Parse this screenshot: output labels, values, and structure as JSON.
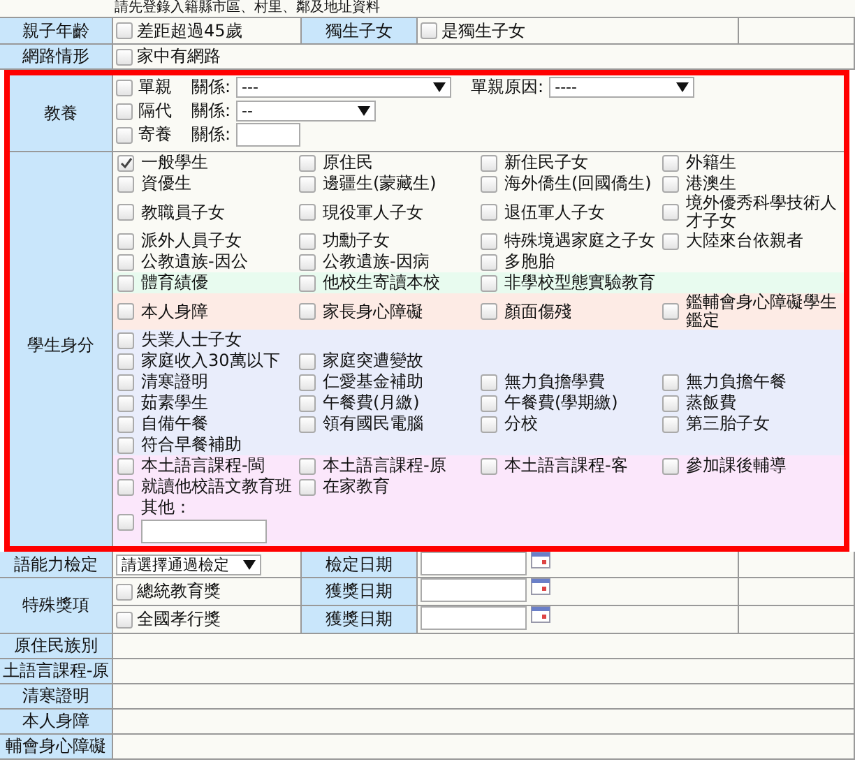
{
  "note": "請先登錄入籍縣市區、村里、鄰及地址資料",
  "parent_age": {
    "label": "親子年齡",
    "option": {
      "label": "差距超過45歲",
      "checked": false
    },
    "label2": "獨生子女",
    "option2": {
      "label": "是獨生子女",
      "checked": false
    }
  },
  "internet": {
    "label": "網路情形",
    "option": {
      "label": "家中有網路",
      "checked": false
    }
  },
  "upbringing": {
    "label": "教養",
    "items": [
      {
        "label": "單親",
        "checked": false,
        "relation_label": "關係:",
        "kind": "select",
        "value": "---",
        "reason_label": "單親原因:",
        "reason_value": "----"
      },
      {
        "label": "隔代",
        "checked": false,
        "relation_label": "關係:",
        "kind": "select",
        "value": "--"
      },
      {
        "label": "寄養",
        "checked": false,
        "relation_label": "關係:",
        "kind": "input"
      }
    ]
  },
  "identity": {
    "label": "學生身分",
    "groups": [
      {
        "color": "#fafaf5",
        "rows": [
          [
            {
              "label": "一般學生",
              "checked": true
            },
            {
              "label": "原住民",
              "checked": false
            },
            {
              "label": "新住民子女",
              "checked": false
            },
            {
              "label": "外籍生",
              "checked": false
            }
          ],
          [
            {
              "label": "資優生",
              "checked": false
            },
            {
              "label": "邊疆生(蒙藏生)",
              "checked": false
            },
            {
              "label": "海外僑生(回國僑生)",
              "checked": false
            },
            {
              "label": "港澳生",
              "checked": false
            }
          ],
          [
            {
              "label": "教職員子女",
              "checked": false
            },
            {
              "label": "現役軍人子女",
              "checked": false
            },
            {
              "label": "退伍軍人子女",
              "checked": false
            },
            {
              "label": "境外優秀科學技術人才子女",
              "checked": false
            }
          ],
          [
            {
              "label": "派外人員子女",
              "checked": false
            },
            {
              "label": "功勳子女",
              "checked": false
            },
            {
              "label": "特殊境遇家庭之子女",
              "checked": false
            },
            {
              "label": "大陸來台依親者",
              "checked": false
            }
          ],
          [
            {
              "label": "公教遺族-因公",
              "checked": false
            },
            {
              "label": "公教遺族-因病",
              "checked": false
            },
            {
              "label": "多胞胎",
              "checked": false
            }
          ]
        ]
      },
      {
        "color": "#e8fbef",
        "rows": [
          [
            {
              "label": "體育績優",
              "checked": false
            },
            {
              "label": "他校生寄讀本校",
              "checked": false
            },
            {
              "label": "非學校型態實驗教育",
              "checked": false
            }
          ]
        ]
      },
      {
        "color": "#fdebe5",
        "rows": [
          [
            {
              "label": "本人身障",
              "checked": false
            },
            {
              "label": "家長身心障礙",
              "checked": false
            },
            {
              "label": "顏面傷殘",
              "checked": false
            },
            {
              "label": "鑑輔會身心障礙學生鑑定",
              "checked": false
            }
          ]
        ]
      },
      {
        "color": "#e9edfb",
        "rows": [
          [
            {
              "label": "失業人士子女",
              "checked": false
            }
          ],
          [
            {
              "label": "家庭收入30萬以下",
              "checked": false
            },
            {
              "label": "家庭突遭變故",
              "checked": false
            }
          ],
          [
            {
              "label": "清寒證明",
              "checked": false
            },
            {
              "label": "仁愛基金補助",
              "checked": false
            },
            {
              "label": "無力負擔學費",
              "checked": false
            },
            {
              "label": "無力負擔午餐",
              "checked": false
            }
          ],
          [
            {
              "label": "茹素學生",
              "checked": false
            },
            {
              "label": "午餐費(月繳)",
              "checked": false
            },
            {
              "label": "午餐費(學期繳)",
              "checked": false
            },
            {
              "label": "蒸飯費",
              "checked": false
            }
          ],
          [
            {
              "label": "自備午餐",
              "checked": false
            },
            {
              "label": "領有國民電腦",
              "checked": false
            },
            {
              "label": "分校",
              "checked": false
            },
            {
              "label": "第三胎子女",
              "checked": false
            }
          ],
          [
            {
              "label": "符合早餐補助",
              "checked": false
            }
          ]
        ]
      },
      {
        "color": "#fbe7fb",
        "rows": [
          [
            {
              "label": "本土語言課程-閩",
              "checked": false
            },
            {
              "label": "本土語言課程-原",
              "checked": false
            },
            {
              "label": "本土語言課程-客",
              "checked": false
            },
            {
              "label": "參加課後輔導",
              "checked": false
            }
          ],
          [
            {
              "label": "就讀他校語文教育班",
              "checked": false
            },
            {
              "label": "在家教育",
              "checked": false
            }
          ],
          [
            {
              "label": "其他：",
              "checked": false,
              "kind": "other"
            }
          ]
        ]
      }
    ]
  },
  "english": {
    "label": "語能力檢定",
    "select": "請選擇通過檢定",
    "date_label": "檢定日期"
  },
  "awards": {
    "label": "特殊獎項",
    "items": [
      {
        "label": "總統教育獎",
        "checked": false,
        "date_label": "獲獎日期"
      },
      {
        "label": "全國孝行獎",
        "checked": false,
        "date_label": "獲獎日期"
      }
    ]
  },
  "summary_rows": [
    "原住民族別",
    "土語言課程-原",
    "清寒證明",
    "本人身障",
    "輔會身心障礙"
  ]
}
